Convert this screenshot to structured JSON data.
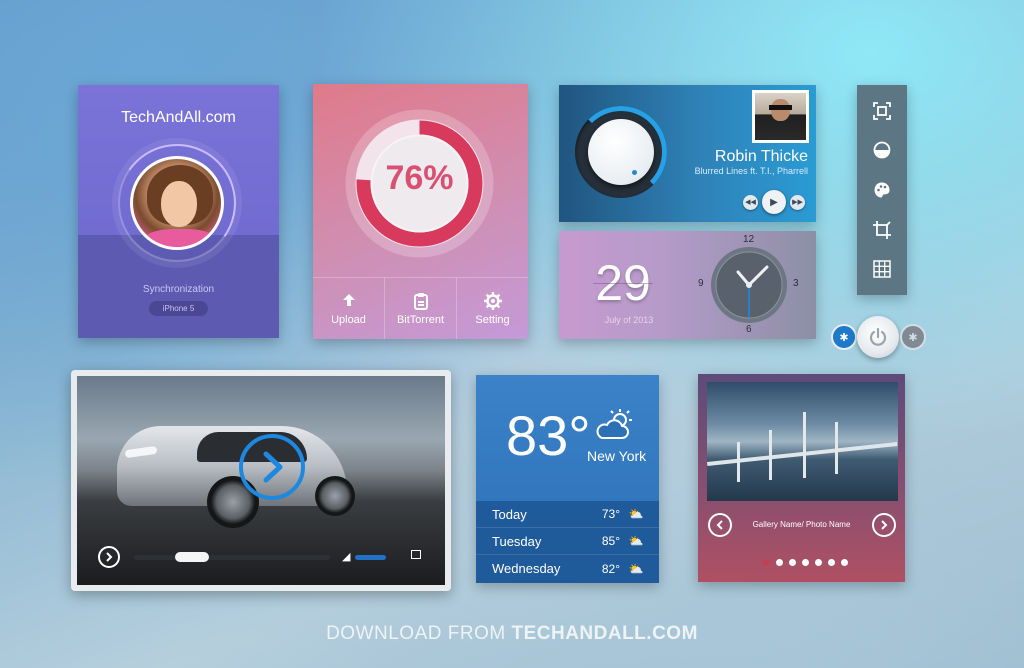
{
  "profile": {
    "title": "TechAndAll.com",
    "status": "Synchronization",
    "device": "iPhone 5"
  },
  "progress": {
    "percent_label": "76%",
    "percent_value": 76,
    "actions": [
      {
        "label": "Upload",
        "icon": "upload-arrow-icon"
      },
      {
        "label": "BitTorrent",
        "icon": "clipboard-icon"
      },
      {
        "label": "Setting",
        "icon": "gear-icon"
      }
    ]
  },
  "music": {
    "artist": "Robin Thicke",
    "song": "Blurred Lines ft. T.I., Pharrell",
    "controls": [
      "rewind-icon",
      "play-icon",
      "fast-forward-icon"
    ]
  },
  "date": {
    "day": "29",
    "month_year": "July of 2013",
    "clock_labels": {
      "twelve": "12",
      "three": "3",
      "six": "6",
      "nine": "9"
    }
  },
  "toolbar": {
    "icons": [
      "fullscreen-frame-icon",
      "half-circle-icon",
      "palette-icon",
      "crop-icon",
      "grid-icon"
    ]
  },
  "toggles": {
    "left": "bluetooth-icon",
    "center": "power-icon",
    "right": "bluetooth-icon"
  },
  "video": {
    "progress_fraction": 0.25,
    "volume_fraction": 0.9
  },
  "weather": {
    "temperature": "83°",
    "city": "New York",
    "forecast": [
      {
        "day": "Today",
        "temp": "73°",
        "icon": "partly-sunny-icon"
      },
      {
        "day": "Tuesday",
        "temp": "85°",
        "icon": "partly-sunny-icon"
      },
      {
        "day": "Wednesday",
        "temp": "82°",
        "icon": "partly-sunny-icon"
      }
    ]
  },
  "gallery": {
    "caption": "Gallery Name/ Photo Name",
    "dot_count": 7,
    "active_dot": 0
  },
  "footer": {
    "prefix": "DOWNLOAD FROM ",
    "brand": "TECHANDALL.COM"
  },
  "colors": {
    "accent_blue": "#1d88e0",
    "progress_red": "#d73a5c",
    "gallery_active_dot": "#c33f55"
  }
}
